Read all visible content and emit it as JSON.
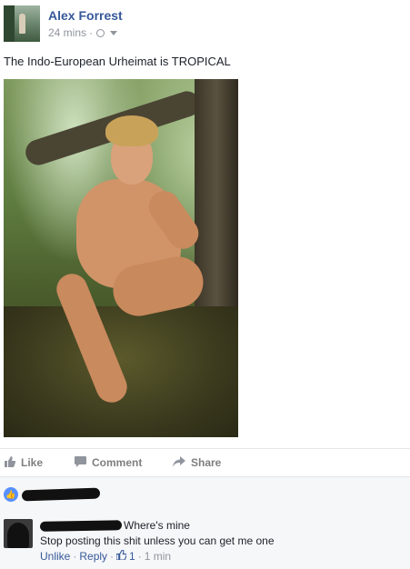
{
  "post": {
    "author": "Alex Forrest",
    "time": "24 mins",
    "separator": "·",
    "text": "The Indo-European Urheimat is TROPICAL",
    "privacy_icon": "globe-icon",
    "audience_icon": "caret-down-icon"
  },
  "actions": {
    "like_label": "Like",
    "comment_label": "Comment",
    "share_label": "Share"
  },
  "comment": {
    "text_tail": "Where's mine",
    "reply_text": "Stop posting this shit unless you can get me one",
    "unlike_label": "Unlike",
    "reply_label": "Reply",
    "separator": "·",
    "likes_count": "1",
    "time": "1 min"
  },
  "colors": {
    "link": "#365899",
    "muted": "#90949c",
    "like_badge": "#5890ff"
  }
}
